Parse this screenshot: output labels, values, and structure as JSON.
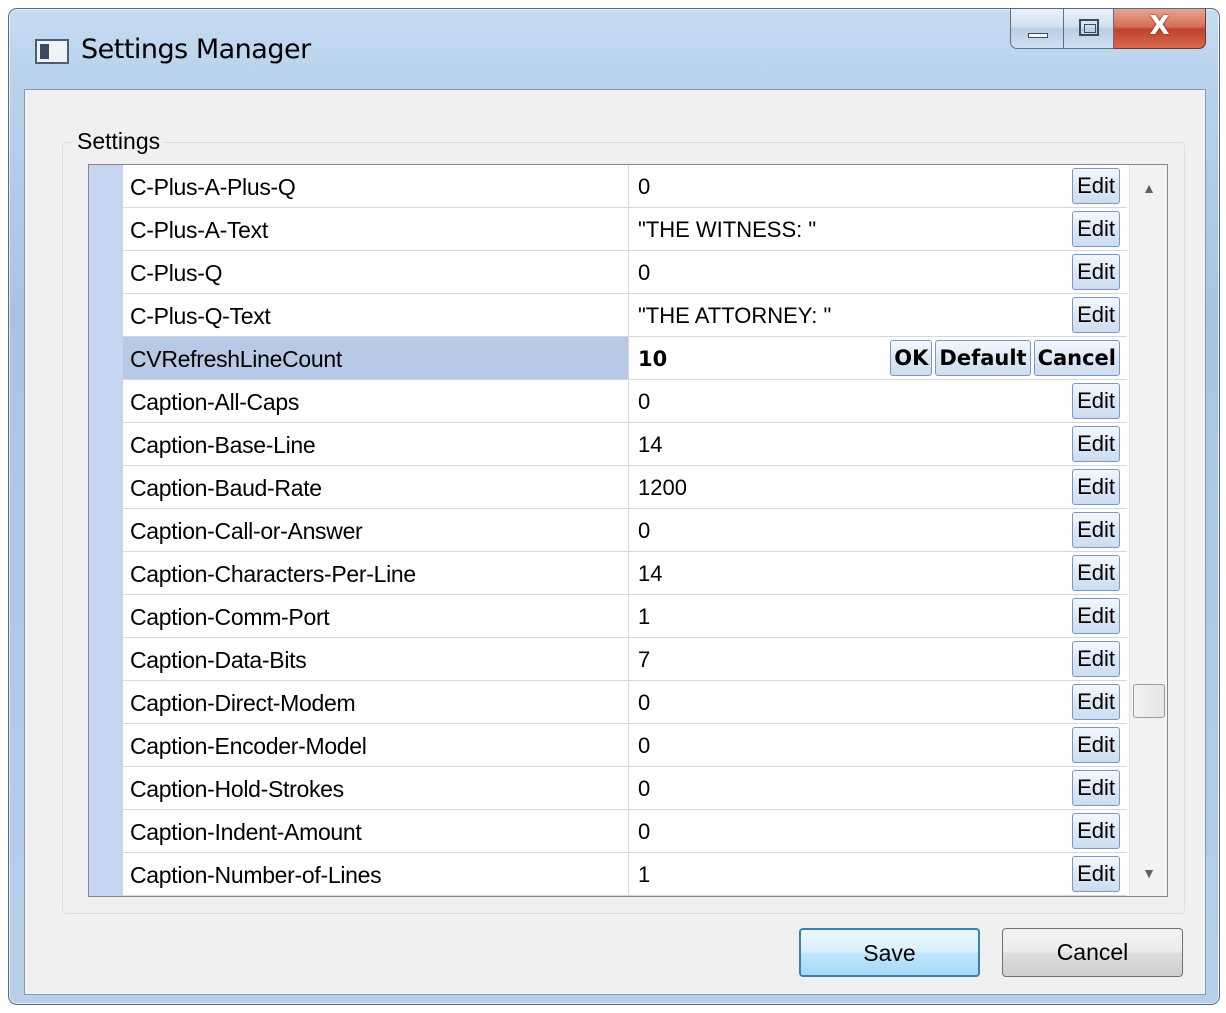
{
  "window": {
    "title": "Settings Manager"
  },
  "caption_buttons": {
    "minimize_icon": "minimize-icon",
    "maximize_icon": "maximize-icon",
    "close_glyph": "X"
  },
  "group": {
    "legend": "Settings"
  },
  "grid": {
    "edit_label": "Edit",
    "inline_actions": {
      "ok": "OK",
      "default": "Default",
      "cancel": "Cancel"
    },
    "rows": [
      {
        "name": "C-Plus-A-Plus-Q",
        "value": "0"
      },
      {
        "name": "C-Plus-A-Text",
        "value": "\"THE WITNESS: \""
      },
      {
        "name": "C-Plus-Q",
        "value": "0"
      },
      {
        "name": "C-Plus-Q-Text",
        "value": "\"THE ATTORNEY: \""
      },
      {
        "name": "CVRefreshLineCount",
        "value": "10",
        "editing": true
      },
      {
        "name": "Caption-All-Caps",
        "value": "0"
      },
      {
        "name": "Caption-Base-Line",
        "value": "14"
      },
      {
        "name": "Caption-Baud-Rate",
        "value": "1200"
      },
      {
        "name": "Caption-Call-or-Answer",
        "value": "0"
      },
      {
        "name": "Caption-Characters-Per-Line",
        "value": "14"
      },
      {
        "name": "Caption-Comm-Port",
        "value": "1"
      },
      {
        "name": "Caption-Data-Bits",
        "value": "7"
      },
      {
        "name": "Caption-Direct-Modem",
        "value": "0"
      },
      {
        "name": "Caption-Encoder-Model",
        "value": "0"
      },
      {
        "name": "Caption-Hold-Strokes",
        "value": "0"
      },
      {
        "name": "Caption-Indent-Amount",
        "value": "0"
      },
      {
        "name": "Caption-Number-of-Lines",
        "value": "1"
      }
    ],
    "scroll_position": 0.78
  },
  "footer": {
    "save_label": "Save",
    "cancel_label": "Cancel"
  }
}
